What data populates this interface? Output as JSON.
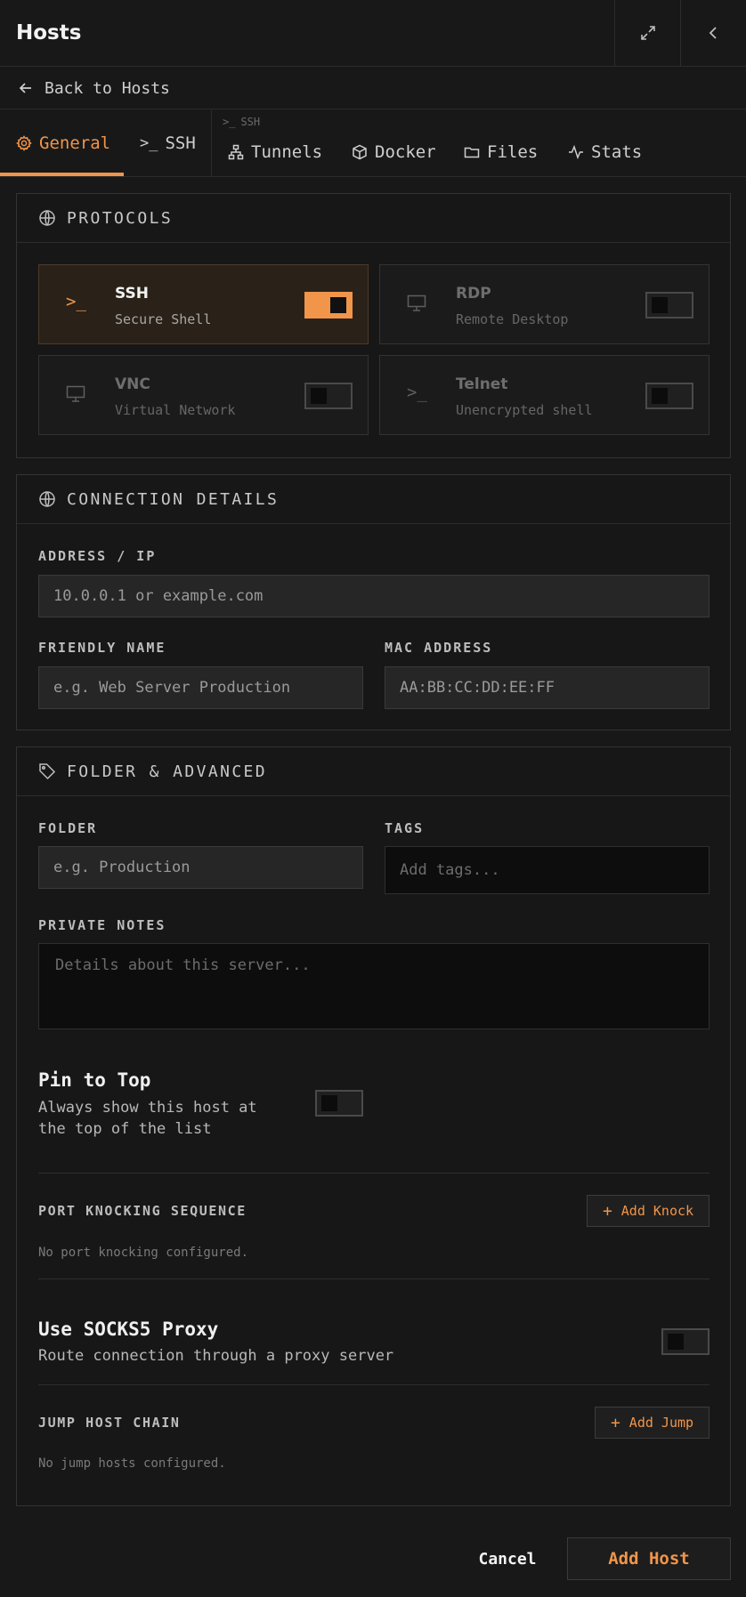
{
  "header": {
    "title": "Hosts"
  },
  "back": {
    "label": "Back to Hosts"
  },
  "tabs": [
    {
      "label": "General",
      "icon": "gear-icon",
      "active": true
    },
    {
      "label": "SSH",
      "icon": "terminal-icon"
    },
    {
      "label": "Tunnels",
      "icon": "network-icon"
    },
    {
      "label": "Docker",
      "icon": "box-icon"
    },
    {
      "label": "Files",
      "icon": "folder-icon"
    },
    {
      "label": "Stats",
      "icon": "activity-icon"
    }
  ],
  "tab_group_label": "SSH",
  "protocols": {
    "title": "PROTOCOLS",
    "items": [
      {
        "name": "SSH",
        "desc": "Secure Shell",
        "enabled": true,
        "icon": "terminal-icon"
      },
      {
        "name": "RDP",
        "desc": "Remote Desktop",
        "enabled": false,
        "icon": "monitor-icon"
      },
      {
        "name": "VNC",
        "desc": "Virtual Network",
        "enabled": false,
        "icon": "monitor-icon"
      },
      {
        "name": "Telnet",
        "desc": "Unencrypted shell",
        "enabled": false,
        "icon": "terminal-icon"
      }
    ]
  },
  "connection": {
    "title": "CONNECTION DETAILS",
    "address_label": "ADDRESS / IP",
    "address_placeholder": "10.0.0.1 or example.com",
    "friendly_label": "FRIENDLY NAME",
    "friendly_placeholder": "e.g. Web Server Production",
    "mac_label": "MAC ADDRESS",
    "mac_placeholder": "AA:BB:CC:DD:EE:FF"
  },
  "folder_adv": {
    "title": "FOLDER & ADVANCED",
    "folder_label": "FOLDER",
    "folder_placeholder": "e.g. Production",
    "tags_label": "TAGS",
    "tags_placeholder": "Add tags...",
    "notes_label": "PRIVATE NOTES",
    "notes_placeholder": "Details about this server...",
    "pin_title": "Pin to Top",
    "pin_desc_1": "Always show this host at",
    "pin_desc_2": "the top of the list",
    "pin_enabled": false,
    "knock_label": "PORT KNOCKING SEQUENCE",
    "knock_button": "Add Knock",
    "knock_empty": "No port knocking configured.",
    "socks_title": "Use SOCKS5 Proxy",
    "socks_desc": "Route connection through a proxy server",
    "socks_enabled": false,
    "jump_label": "JUMP HOST CHAIN",
    "jump_button": "Add Jump",
    "jump_empty": "No jump hosts configured."
  },
  "footer": {
    "cancel": "Cancel",
    "submit": "Add Host"
  },
  "colors": {
    "accent": "#f0954a",
    "background": "#181818"
  }
}
